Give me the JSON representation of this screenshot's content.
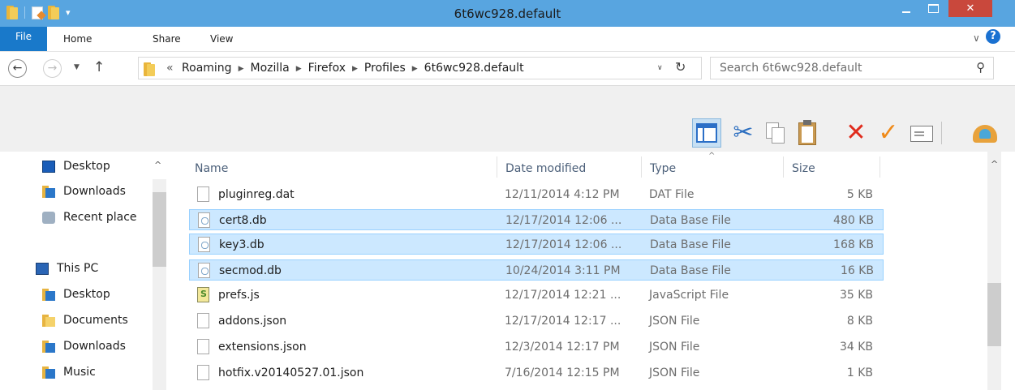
{
  "window": {
    "title": "6t6wc928.default",
    "close_symbol": "✕"
  },
  "ribbon": {
    "tabs": [
      "File",
      "Home",
      "Share",
      "View"
    ],
    "help_symbol": "?"
  },
  "address": {
    "lead": "«",
    "breadcrumbs": [
      "Roaming",
      "Mozilla",
      "Firefox",
      "Profiles",
      "6t6wc928.default"
    ],
    "separator": "▶",
    "search_placeholder": "Search 6t6wc928.default"
  },
  "toolbar": {
    "icons": [
      "layout-pane-icon",
      "cut-icon",
      "copy-icon",
      "paste-icon",
      "delete-icon",
      "rename-check-icon",
      "properties-icon",
      "shell-icon"
    ]
  },
  "nav": {
    "items": [
      "Desktop",
      "Downloads",
      "Recent place",
      "This PC",
      "Desktop",
      "Documents",
      "Downloads",
      "Music"
    ]
  },
  "columns": {
    "name": "Name",
    "date": "Date modified",
    "type": "Type",
    "size": "Size"
  },
  "files": [
    {
      "name": "pluginreg.dat",
      "date": "12/11/2014 4:12 PM",
      "type": "DAT File",
      "size": "5 KB",
      "selected": false,
      "icon": "file-icon"
    },
    {
      "name": "cert8.db",
      "date": "12/17/2014 12:06 ...",
      "type": "Data Base File",
      "size": "480 KB",
      "selected": true,
      "icon": "database-file-icon"
    },
    {
      "name": "key3.db",
      "date": "12/17/2014 12:06 ...",
      "type": "Data Base File",
      "size": "168 KB",
      "selected": true,
      "icon": "database-file-icon"
    },
    {
      "name": "secmod.db",
      "date": "10/24/2014 3:11 PM",
      "type": "Data Base File",
      "size": "16 KB",
      "selected": true,
      "icon": "database-file-icon"
    },
    {
      "name": "prefs.js",
      "date": "12/17/2014 12:21 ...",
      "type": "JavaScript File",
      "size": "35 KB",
      "selected": false,
      "icon": "javascript-file-icon"
    },
    {
      "name": "addons.json",
      "date": "12/17/2014 12:17 ...",
      "type": "JSON File",
      "size": "8 KB",
      "selected": false,
      "icon": "file-icon"
    },
    {
      "name": "extensions.json",
      "date": "12/3/2014 12:17 PM",
      "type": "JSON File",
      "size": "34 KB",
      "selected": false,
      "icon": "file-icon"
    },
    {
      "name": "hotfix.v20140527.01.json",
      "date": "7/16/2014 12:15 PM",
      "type": "JSON File",
      "size": "1 KB",
      "selected": false,
      "icon": "file-icon"
    }
  ]
}
